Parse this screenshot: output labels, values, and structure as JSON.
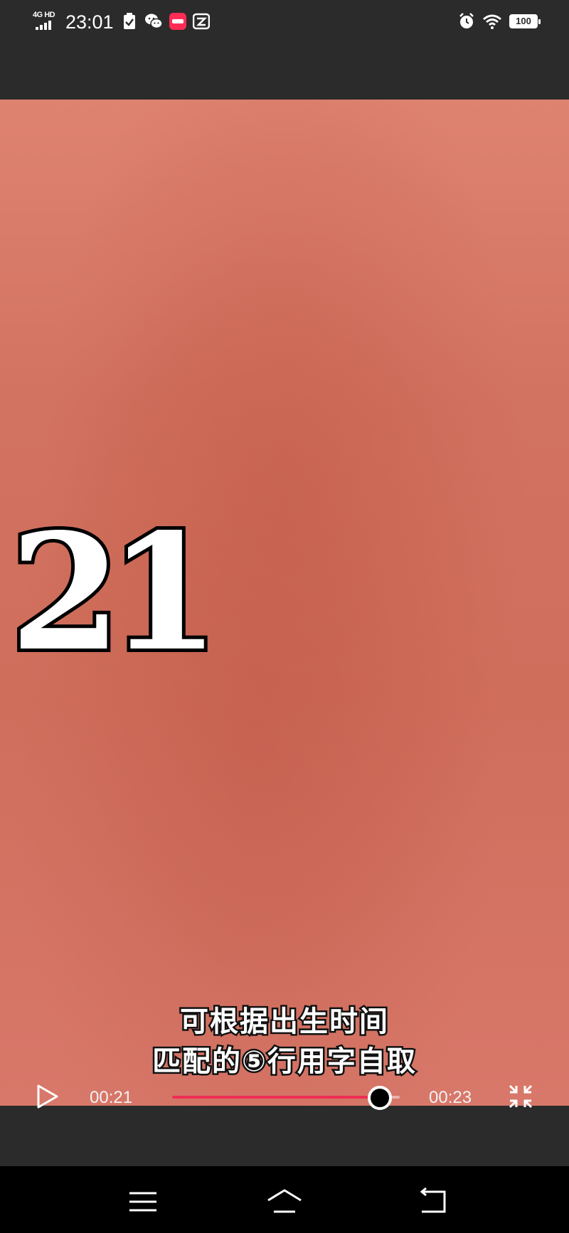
{
  "status_bar": {
    "network": "4G HD",
    "time": "23:01",
    "battery": "100",
    "icons": [
      "signal-icon",
      "checklist-icon",
      "wechat-icon",
      "app-badge-icon",
      "wallet-icon",
      "alarm-icon",
      "wifi-icon",
      "battery-icon"
    ]
  },
  "video": {
    "overlay_number": "21",
    "subtitle_line1": "可根据出生时间",
    "subtitle_line2": "匹配的⑤行用字自取"
  },
  "player": {
    "current_time": "00:21",
    "duration": "00:23",
    "progress": 0.9,
    "accent_color": "#ee2d55"
  },
  "nav_bar": {
    "buttons": [
      "menu-icon",
      "home-icon",
      "back-icon"
    ]
  },
  "colors": {
    "background": "#2b2b2b",
    "video_bg": "#d27260"
  }
}
